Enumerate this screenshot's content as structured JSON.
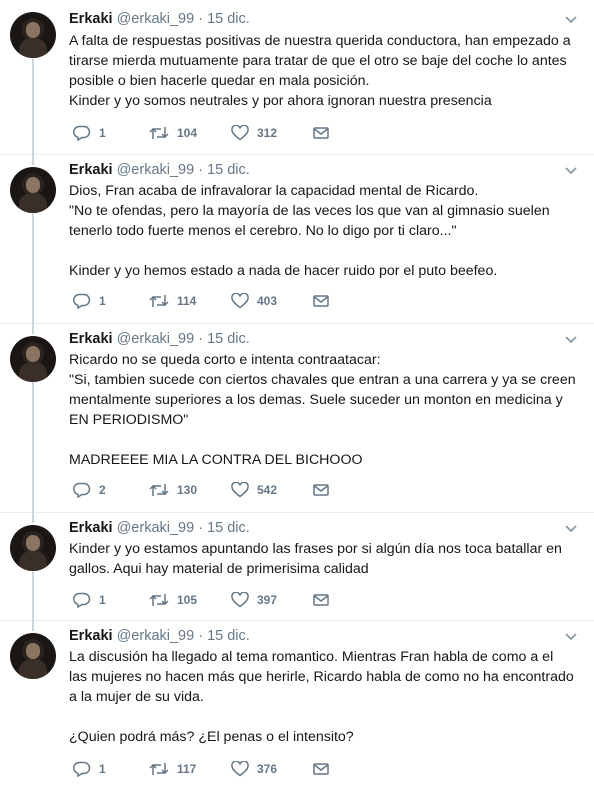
{
  "tweets": [
    {
      "name": "Erkaki",
      "handle": "@erkaki_99",
      "sep": "·",
      "date": "15 dic.",
      "lines": [
        "A falta de respuestas positivas de nuestra querida conductora, han empezado a",
        "tirarse mierda mutuamente para tratar de que el otro se baje del coche lo antes",
        "posible o bien hacerle quedar en mala posición.",
        "Kinder y yo somos neutrales y por ahora ignoran nuestra presencia"
      ],
      "replies": "1",
      "retweets": "104",
      "likes": "312"
    },
    {
      "name": "Erkaki",
      "handle": "@erkaki_99",
      "sep": "·",
      "date": "15 dic.",
      "lines": [
        "Dios, Fran acaba de infravalorar la capacidad mental de Ricardo.",
        "\"No te ofendas, pero la mayoría de las veces los que van al gimnasio suelen",
        "tenerlo todo fuerte menos el cerebro. No lo digo por ti claro...\"",
        "",
        "Kinder y yo hemos estado a nada de hacer ruido por el puto beefeo."
      ],
      "replies": "1",
      "retweets": "114",
      "likes": "403"
    },
    {
      "name": "Erkaki",
      "handle": "@erkaki_99",
      "sep": "·",
      "date": "15 dic.",
      "lines": [
        "Ricardo no se queda corto e intenta contraatacar:",
        "\"Si, tambien sucede con ciertos chavales que entran a una carrera y ya se creen",
        "mentalmente superiores a los demas. Suele suceder un monton en medicina y",
        "EN PERIODISMO\"",
        "",
        "MADREEEE MIA LA CONTRA DEL BICHOOO"
      ],
      "replies": "2",
      "retweets": "130",
      "likes": "542"
    },
    {
      "name": "Erkaki",
      "handle": "@erkaki_99",
      "sep": "·",
      "date": "15 dic.",
      "lines": [
        "Kinder y yo estamos apuntando las frases por si algún día nos toca batallar en",
        "gallos. Aqui hay material de primerisima calidad"
      ],
      "replies": "1",
      "retweets": "105",
      "likes": "397"
    },
    {
      "name": "Erkaki",
      "handle": "@erkaki_99",
      "sep": "·",
      "date": "15 dic.",
      "lines": [
        "La discusión ha llegado al tema romantico. Mientras Fran habla de como a el",
        "las mujeres no hacen más que herirle, Ricardo habla de como no ha encontrado",
        "a la mujer de su vida.",
        "",
        "¿Quien podrá más? ¿El penas o el intensito?"
      ],
      "replies": "1",
      "retweets": "117",
      "likes": "376"
    }
  ],
  "icons": {
    "reply": "reply-icon",
    "retweet": "retweet-icon",
    "like": "heart-icon",
    "dm": "envelope-icon",
    "menu": "chevron-down-icon",
    "color_gray": "#657786",
    "color_thread": "#ccd6dd"
  }
}
